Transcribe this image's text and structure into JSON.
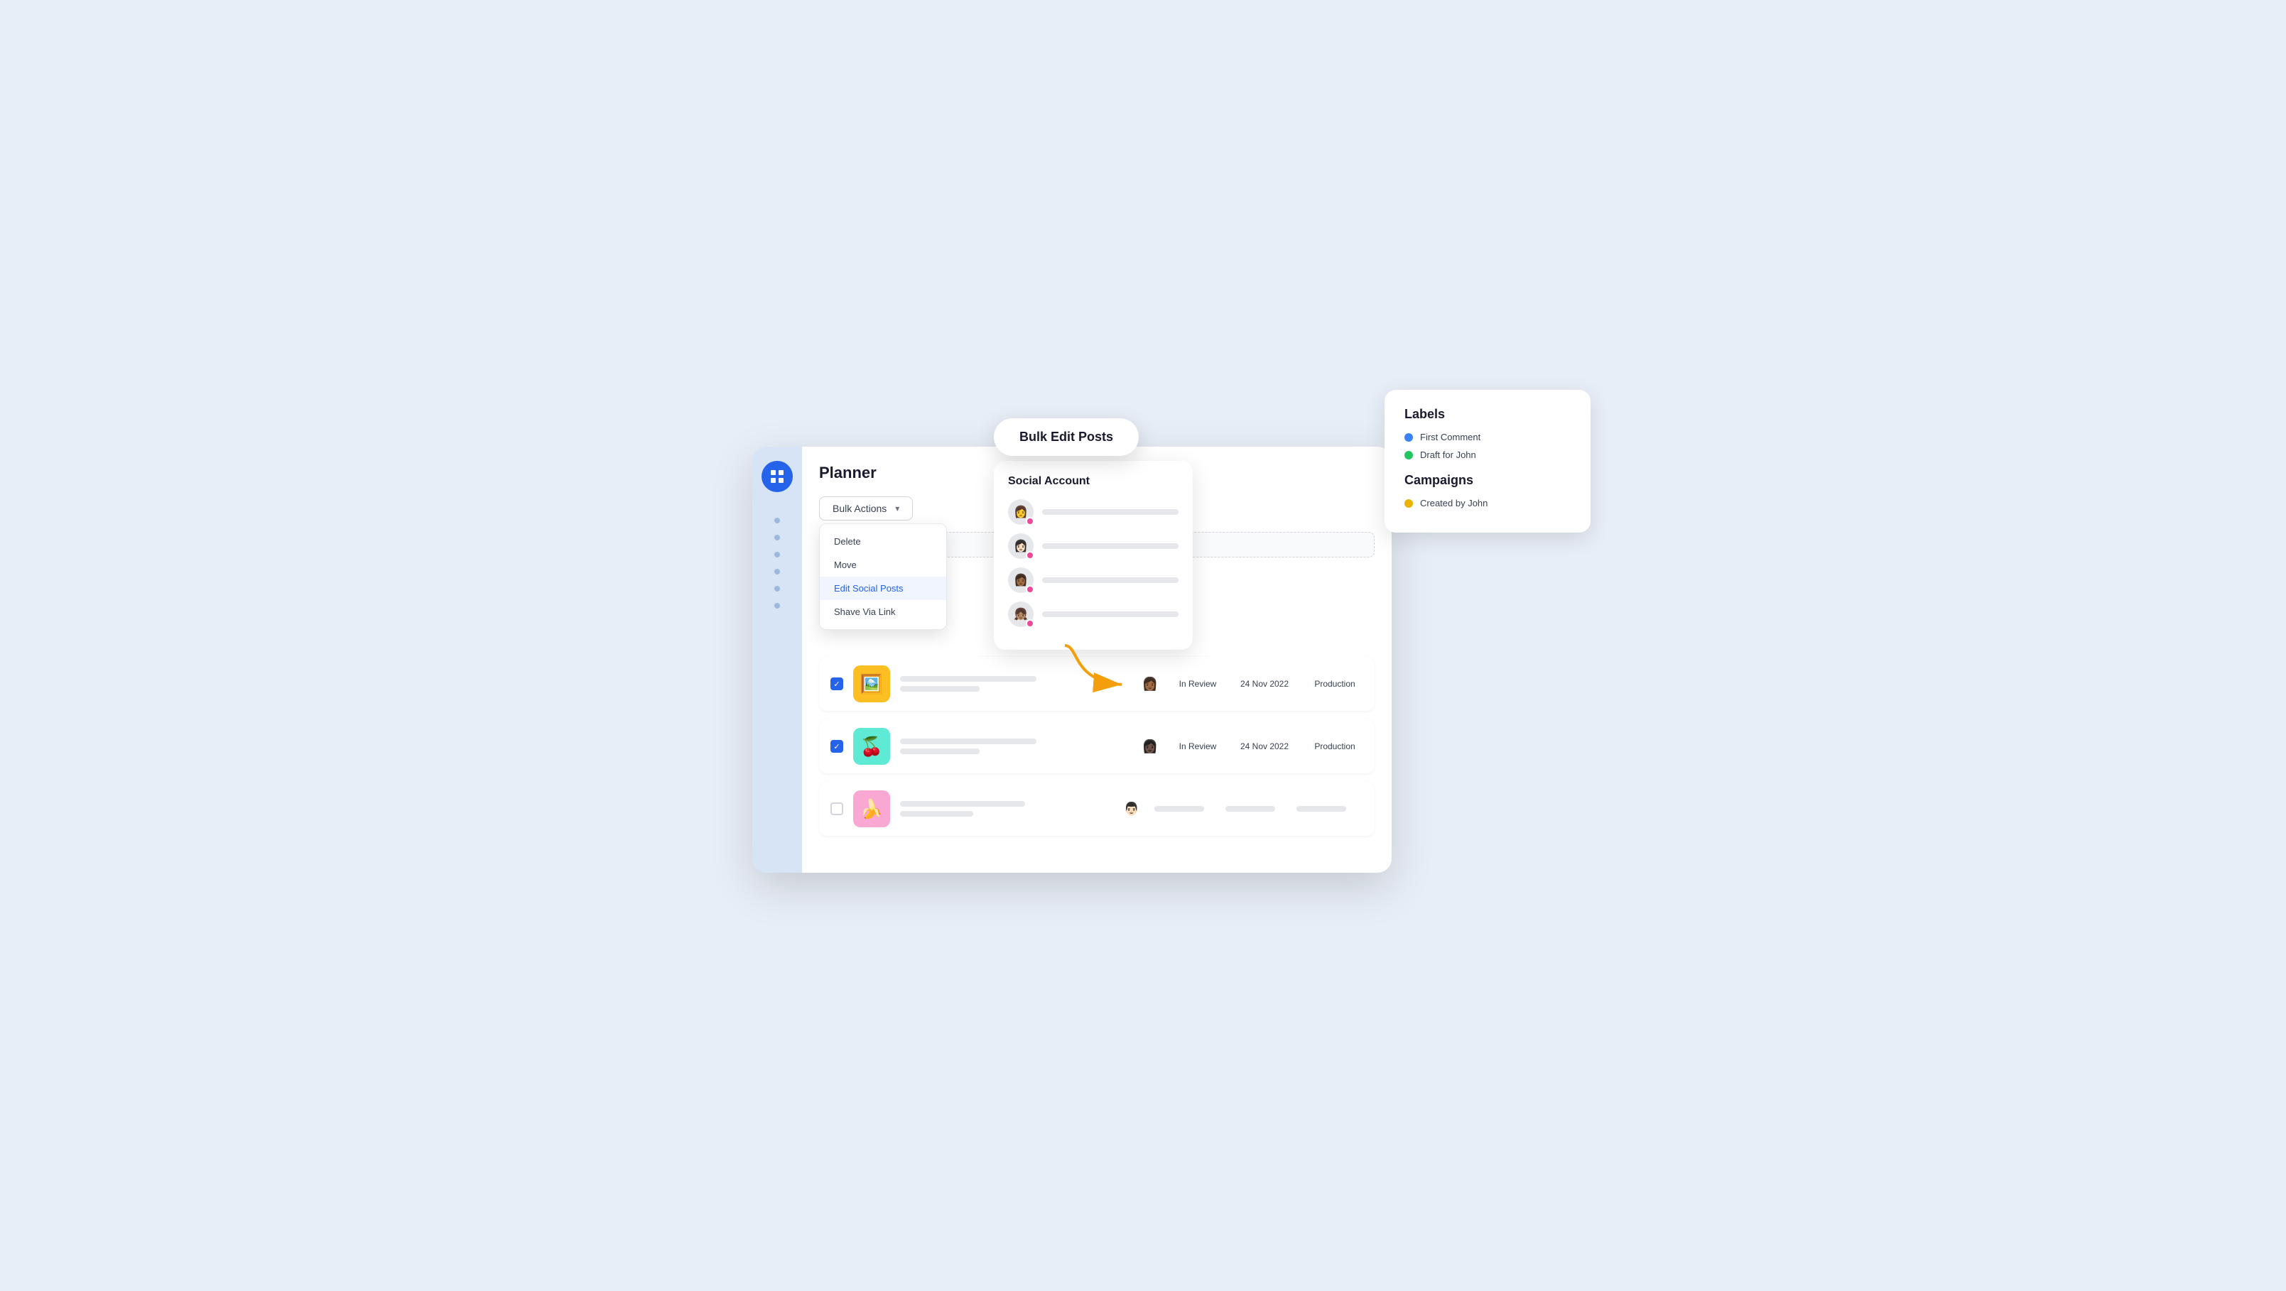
{
  "page": {
    "title": "Planner"
  },
  "sidebar": {
    "logo_icon": "grid-icon",
    "dots": [
      "dot1",
      "dot2",
      "dot3",
      "dot4",
      "dot5",
      "dot6"
    ]
  },
  "bulk_actions": {
    "button_label": "Bulk Actions",
    "chevron": "▾",
    "menu_items": [
      {
        "id": "delete",
        "label": "Delete"
      },
      {
        "id": "move",
        "label": "Move"
      },
      {
        "id": "edit-social",
        "label": "Edit Social Posts",
        "highlighted": true
      },
      {
        "id": "shave",
        "label": "Shave Via Link"
      }
    ]
  },
  "post_rows": [
    {
      "id": "row1",
      "checked": true,
      "thumb_emoji": "🟨",
      "thumb_class": "yellow",
      "status": "In Review",
      "date": "24 Nov 2022",
      "campaign": "Production"
    },
    {
      "id": "row2",
      "checked": true,
      "thumb_emoji": "🍒",
      "thumb_class": "teal",
      "status": "In Review",
      "date": "24 Nov 2022",
      "campaign": "Production"
    },
    {
      "id": "row3",
      "checked": false,
      "thumb_emoji": "🍌",
      "thumb_class": "pink",
      "status": "",
      "date": "",
      "campaign": ""
    }
  ],
  "bulk_edit_popup": {
    "title": "Bulk Edit Posts"
  },
  "social_account_popup": {
    "title": "Social Account",
    "accounts": [
      {
        "emoji": "👩",
        "dot_color": "#ec4899"
      },
      {
        "emoji": "👩🏻",
        "dot_color": "#ec4899"
      },
      {
        "emoji": "👩🏾",
        "dot_color": "#ec4899"
      },
      {
        "emoji": "👧🏽",
        "dot_color": "#ec4899"
      }
    ]
  },
  "labels_popup": {
    "labels_title": "Labels",
    "labels": [
      {
        "color": "#3b82f6",
        "text": "First Comment"
      },
      {
        "color": "#22c55e",
        "text": "Draft for John"
      }
    ],
    "campaigns_title": "Campaigns",
    "campaigns": [
      {
        "color": "#eab308",
        "text": "Created by John"
      }
    ]
  },
  "avatars": {
    "row1": "👩🏾",
    "row2": "👩🏿",
    "row3": "👨🏻"
  }
}
